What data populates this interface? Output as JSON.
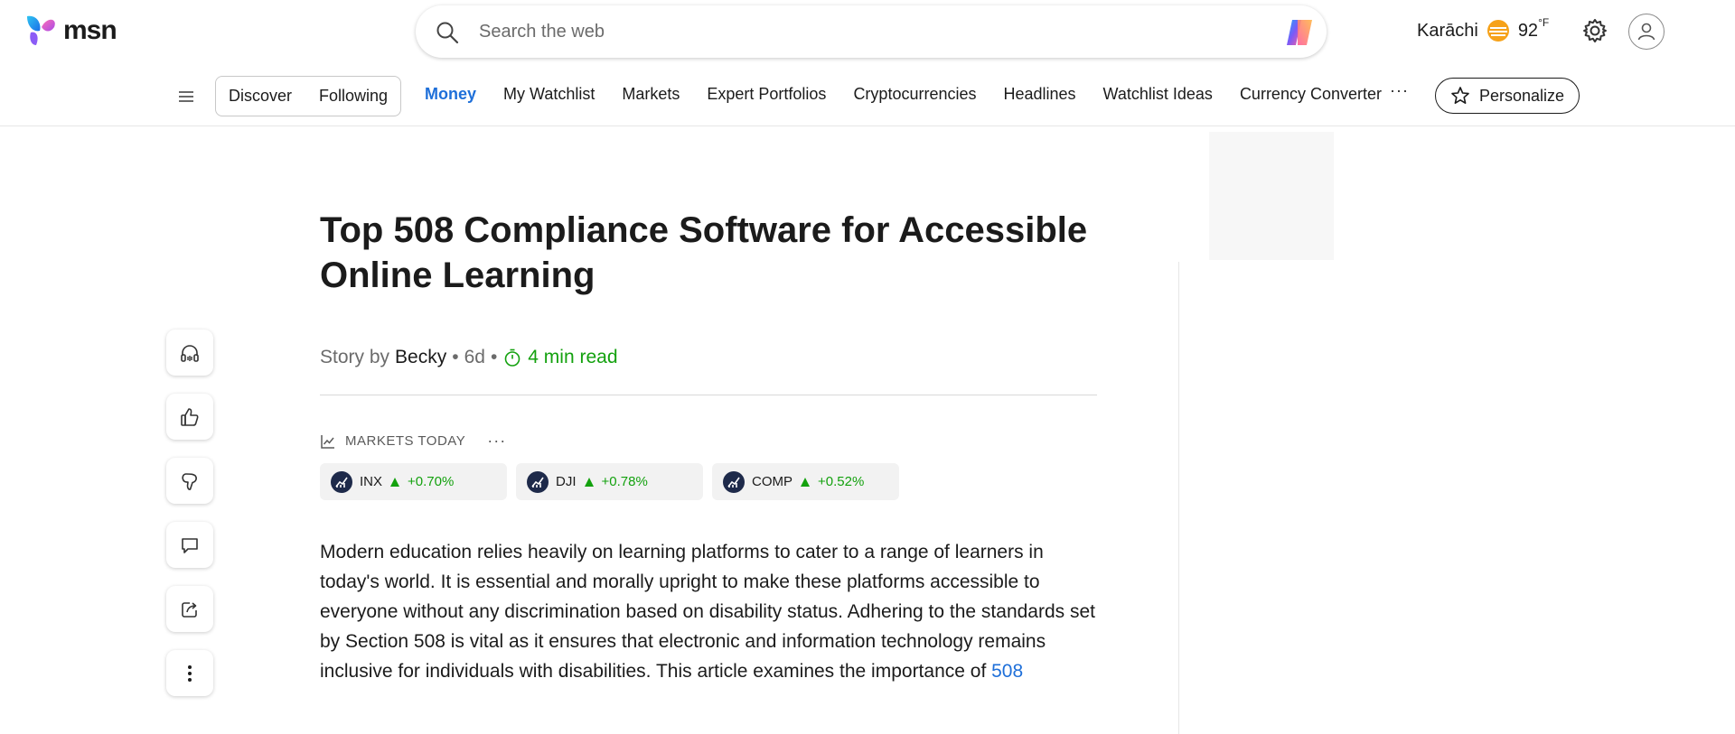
{
  "brand": {
    "logo_text": "msn"
  },
  "search": {
    "placeholder": "Search the web"
  },
  "weather": {
    "city": "Karāchi",
    "temp": "92",
    "unit": "°F"
  },
  "nav": {
    "feed_tabs": [
      "Discover",
      "Following"
    ],
    "links": [
      {
        "label": "Money",
        "active": true
      },
      {
        "label": "My Watchlist"
      },
      {
        "label": "Markets"
      },
      {
        "label": "Expert Portfolios"
      },
      {
        "label": "Cryptocurrencies"
      },
      {
        "label": "Headlines"
      },
      {
        "label": "Watchlist Ideas"
      },
      {
        "label": "Currency Converter"
      }
    ],
    "more": "···",
    "personalize": "Personalize"
  },
  "article": {
    "title": "Top 508 Compliance Software for Accessible Online Learning",
    "byline_prefix": "Story by",
    "author": "Becky",
    "sep": "•",
    "age": "6d",
    "read_time": "4 min read",
    "body_text": "Modern education relies heavily on learning platforms to cater to a range of learners in today's world. It is essential and morally upright to make these platforms accessible to everyone without any discrimination based on disability status. Adhering to the standards set by Section 508 is vital as it ensures that electronic and information technology remains inclusive for individuals with disabilities. This article examines the importance of",
    "body_link": "508"
  },
  "markets": {
    "heading": "MARKETS TODAY",
    "more": "···",
    "tickers": [
      {
        "symbol": "INX",
        "change": "+0.70%"
      },
      {
        "symbol": "DJI",
        "change": "+0.78%"
      },
      {
        "symbol": "COMP",
        "change": "+0.52%"
      }
    ]
  },
  "colors": {
    "accent": "#1e6fd9",
    "positive": "#13a10e"
  }
}
